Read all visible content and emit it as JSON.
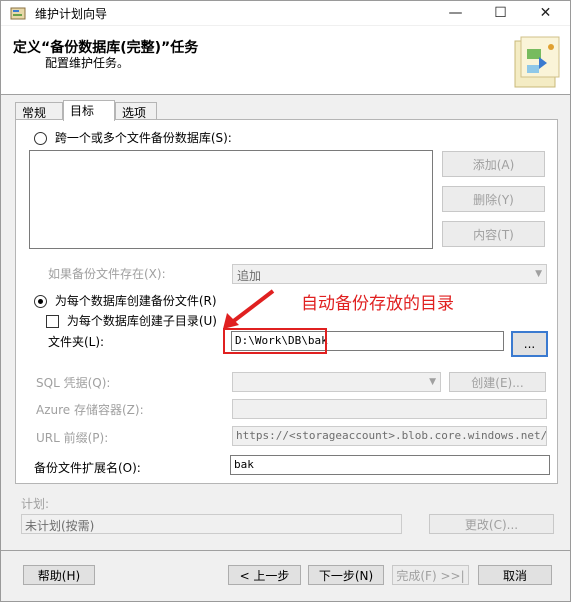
{
  "window": {
    "title": "维护计划向导",
    "controls": {
      "minimize": "—",
      "maximize": "☐",
      "close": "✕"
    }
  },
  "header": {
    "title": "定义“备份数据库(完整)”任务",
    "subtitle": "配置维护任务。"
  },
  "tabs": [
    {
      "label": "常规",
      "active": false
    },
    {
      "label": "目标",
      "active": true
    },
    {
      "label": "选项",
      "active": false
    }
  ],
  "destination": {
    "radio_multi_files": "跨一个或多个文件备份数据库(S):",
    "add_button": "添加(A)",
    "delete_button": "删除(Y)",
    "contents_button": "内容(T)",
    "if_exists_label": "如果备份文件存在(X):",
    "if_exists_value": "追加",
    "radio_per_db": "为每个数据库创建备份文件(R)",
    "subdir_check": "为每个数据库创建子目录(U)",
    "folder_label": "文件夹(L):",
    "folder_value": "D:\\Work\\DB\\bak",
    "browse_button": "...",
    "sql_credential_label": "SQL 凭据(Q):",
    "create_button": "创建(E)...",
    "azure_container_label": "Azure 存储容器(Z):",
    "url_prefix_label": "URL 前缀(P):",
    "url_prefix_value": "https://<storageaccount>.blob.core.windows.net/",
    "extension_label": "备份文件扩展名(O):",
    "extension_value": "bak"
  },
  "annotation": {
    "text": "自动备份存放的目录",
    "color": "#e02020"
  },
  "schedule": {
    "label": "计划:",
    "value": "未计划(按需)",
    "change_button": "更改(C)..."
  },
  "footer": {
    "help": "帮助(H)",
    "back": "< 上一步",
    "next": "下一步(N)",
    "finish": "完成(F) >>|",
    "cancel": "取消"
  }
}
